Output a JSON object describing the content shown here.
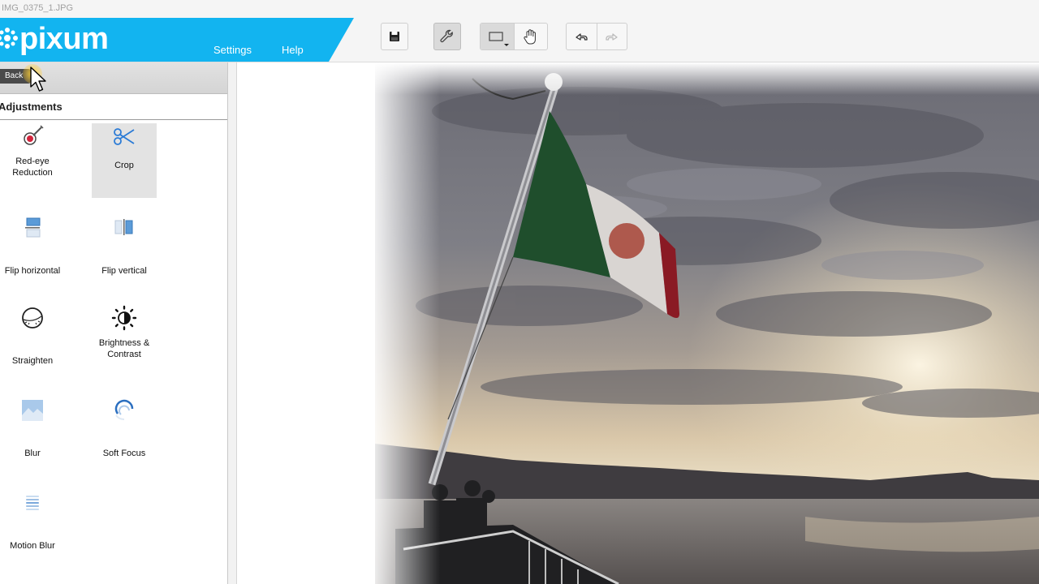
{
  "window": {
    "title": "IMG_0375_1.JPG"
  },
  "brand": {
    "logo_text": "pixum",
    "color": "#12b4f0"
  },
  "nav": {
    "settings": "Settings",
    "help": "Help"
  },
  "toolbar": {
    "save_icon": "save-icon",
    "tools_icon": "wrench-icon",
    "select_icon": "rectangle-select-icon",
    "hand_icon": "hand-icon",
    "undo_icon": "undo-icon",
    "redo_icon": "redo-icon"
  },
  "panel": {
    "back_label": "Back",
    "section_title": "Adjustments",
    "tools": [
      {
        "label": "Red-eye Reduction",
        "icon": "red-eye-icon"
      },
      {
        "label": "Crop",
        "icon": "scissors-icon",
        "selected": true
      },
      {
        "label": "Flip horizontal",
        "icon": "flip-horizontal-icon"
      },
      {
        "label": "Flip vertical",
        "icon": "flip-vertical-icon"
      },
      {
        "label": "Straighten",
        "icon": "straighten-icon"
      },
      {
        "label": "Brightness & Contrast",
        "icon": "brightness-icon"
      },
      {
        "label": "Blur",
        "icon": "blur-icon"
      },
      {
        "label": "Soft Focus",
        "icon": "soft-focus-icon"
      },
      {
        "label": "Motion Blur",
        "icon": "motion-blur-icon"
      }
    ]
  },
  "canvas": {
    "image": "photo-flag-on-ship-at-sunset"
  }
}
